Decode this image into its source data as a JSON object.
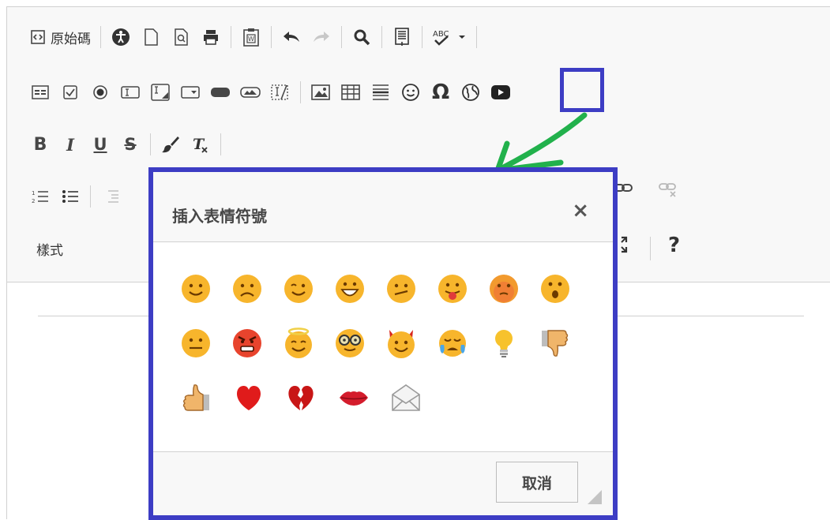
{
  "toolbar": {
    "source_label": "原始碼",
    "styles_label": "樣式",
    "help_label": "?"
  },
  "dialog": {
    "title": "插入表情符號",
    "close_label": "×",
    "cancel_label": "取消"
  },
  "emojis": [
    [
      "smiley",
      "sad",
      "wink",
      "grin",
      "confused",
      "tongue",
      "embarrassed",
      "surprised"
    ],
    [
      "indecision",
      "angry",
      "angel",
      "cool",
      "devil",
      "crying",
      "lightbulb",
      "thumbs-down"
    ],
    [
      "thumbs-up",
      "heart",
      "broken-heart",
      "kiss",
      "envelope"
    ]
  ],
  "colors": {
    "highlight_border": "#3d3dc4",
    "arrow": "#22b14c",
    "emoji_yellow": "#f7b52c"
  }
}
